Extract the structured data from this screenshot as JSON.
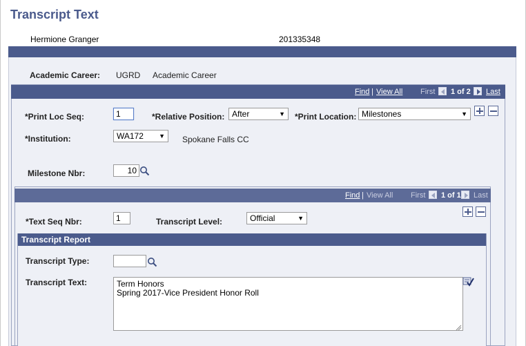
{
  "page": {
    "title": "Transcript Text",
    "student_name": "Hermione Granger",
    "student_id": "201335348"
  },
  "career": {
    "label": "Academic Career:",
    "code": "UGRD",
    "description": "Academic Career"
  },
  "outer_nav": {
    "find": "Find",
    "sep": "|",
    "view_all": "View All",
    "first": "First",
    "count": "1 of 2",
    "last": "Last"
  },
  "outer_form": {
    "print_loc_seq_label": "*Print Loc Seq:",
    "print_loc_seq_value": "1",
    "relative_position_label": "*Relative Position:",
    "relative_position_value": "After",
    "print_location_label": "*Print Location:",
    "print_location_value": "Milestones",
    "institution_label": "*Institution:",
    "institution_value": "WA172",
    "institution_name": "Spokane Falls CC",
    "milestone_label": "Milestone Nbr:",
    "milestone_value": "10"
  },
  "inner_nav": {
    "find": "Find",
    "sep": "|",
    "view_all": "View All",
    "first": "First",
    "count": "1 of 1",
    "last": "Last"
  },
  "inner_form": {
    "text_seq_label": "*Text Seq Nbr:",
    "text_seq_value": "1",
    "transcript_level_label": "Transcript Level:",
    "transcript_level_value": "Official"
  },
  "report": {
    "header": "Transcript Report",
    "type_label": "Transcript Type:",
    "type_value": "",
    "text_label": "Transcript Text:",
    "text_value": "Term Honors\nSpring 2017-Vice President Honor Roll"
  },
  "colors": {
    "title": "#4a5a8c",
    "bar": "#4b5b8c",
    "panel": "#eef0f6"
  }
}
